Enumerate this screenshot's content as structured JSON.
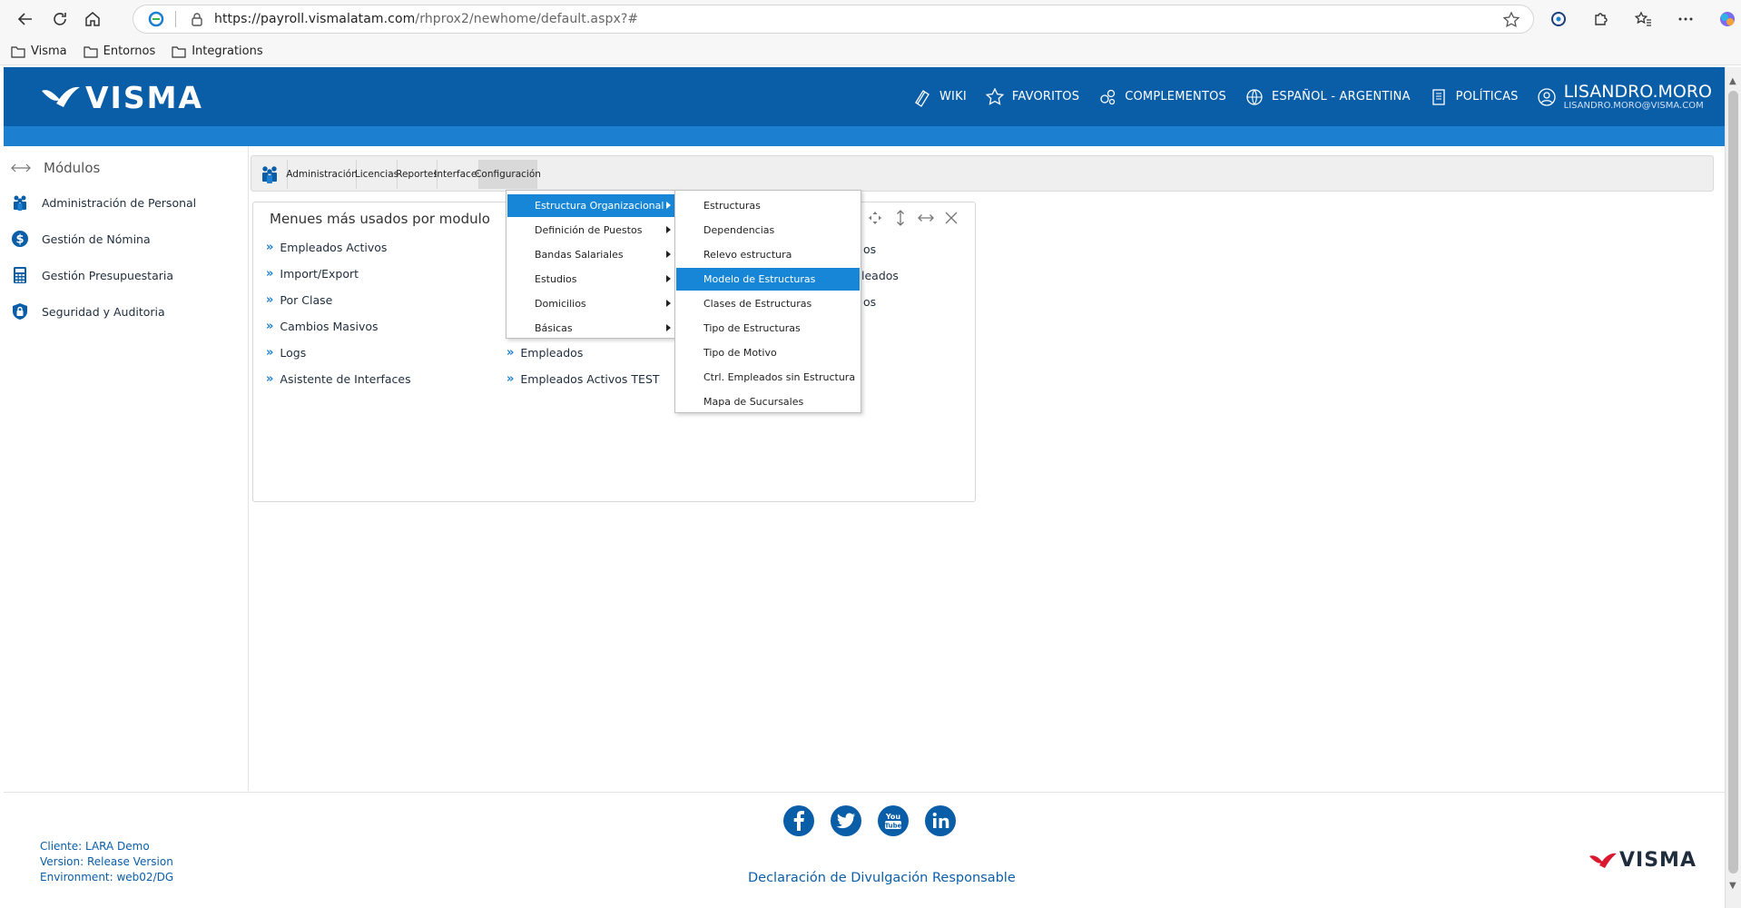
{
  "browser": {
    "url_host": "https://payroll.vismalatam.com",
    "url_path": "/rhprox2/newhome/default.aspx?#",
    "bookmarks": [
      "Visma",
      "Entornos",
      "Integrations"
    ]
  },
  "header": {
    "brand": "VISMA",
    "nav": [
      "WIKI",
      "FAVORITOS",
      "COMPLEMENTOS",
      "ESPAÑOL - ARGENTINA",
      "POLÍTICAS"
    ],
    "user_name": "LISANDRO.MORO",
    "user_email": "LISANDRO.MORO@VISMA.COM",
    "colors": {
      "primary": "#0a5ea8",
      "strip": "#1c7fd0"
    }
  },
  "sidebar": {
    "title": "Módulos",
    "items": [
      {
        "label": "Administración de Personal",
        "icon": "people-icon"
      },
      {
        "label": "Gestión de Nómina",
        "icon": "dollar-icon"
      },
      {
        "label": "Gestión Presupuestaria",
        "icon": "calculator-icon"
      },
      {
        "label": "Seguridad y Auditoria",
        "icon": "lock-icon"
      }
    ]
  },
  "menubar": {
    "items": [
      "Administración",
      "Licencias",
      "Reportes",
      "Interfaces",
      "Configuración"
    ],
    "active": "Configuración"
  },
  "panel": {
    "title": "Menues más usados por modulo",
    "col1": [
      "Empleados Activos",
      "Import/Export",
      "Por Clase",
      "Cambios Masivos",
      "Logs",
      "Asistente de Interfaces"
    ],
    "col2_visible": [
      "Empleados",
      "Empleados Activos TEST"
    ],
    "col3_clipped": [
      "os",
      "leados",
      "os"
    ]
  },
  "config_menu": {
    "items": [
      "Estructura Organizacional",
      "Definición de Puestos",
      "Bandas Salariales",
      "Estudios",
      "Domicilios",
      "Básicas"
    ],
    "highlighted": "Estructura Organizacional"
  },
  "estructura_submenu": {
    "items": [
      "Estructuras",
      "Dependencias",
      "Relevo estructura",
      "Modelo de Estructuras",
      "Clases de Estructuras",
      "Tipo de Estructuras",
      "Tipo de Motivo",
      "Ctrl. Empleados sin Estructura",
      "Mapa de Sucursales"
    ],
    "highlighted": "Modelo de Estructuras",
    "highlight_color": "#1786d6"
  },
  "footer": {
    "client": "Cliente: LARA Demo",
    "version": "Version: Release Version",
    "environment": "Environment: web02/DG",
    "disclosure": "Declaración de Divulgación Responsable",
    "social": [
      "facebook-icon",
      "twitter-icon",
      "youtube-icon",
      "linkedin-icon"
    ],
    "brand": "VISMA"
  }
}
